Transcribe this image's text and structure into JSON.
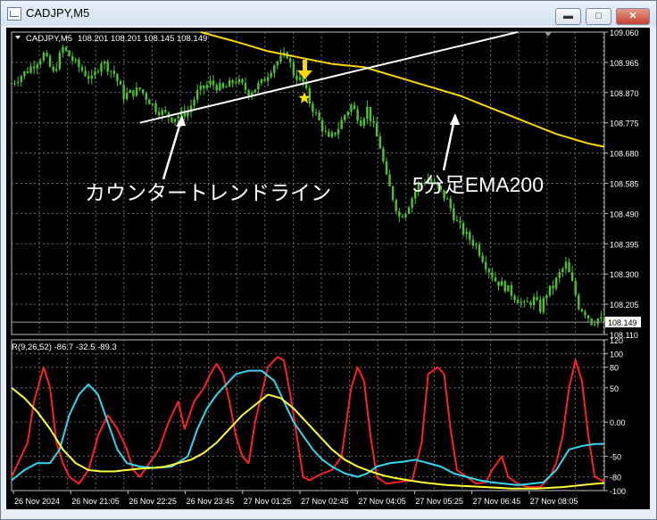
{
  "window": {
    "title": "CADJPY,M5",
    "minimize_glyph": "▬",
    "maximize_glyph": "□",
    "close_glyph": "✕"
  },
  "chart_data": [
    {
      "type": "line",
      "title": "CADJPY,M5  108.201 108.201 108.145 108.149",
      "symbol_label": "CADJPY,M5",
      "ohlc_label": "108.201 108.201 108.145 108.149",
      "ylim": [
        108.11,
        109.06
      ],
      "y_ticks": [
        "109.060",
        "108.965",
        "108.870",
        "108.775",
        "108.680",
        "108.585",
        "108.490",
        "108.395",
        "108.300",
        "108.205",
        "108.110"
      ],
      "current_price": "108.149",
      "x_ticks": [
        "26 Nov 2024",
        "26 Nov 21:05",
        "26 Nov 22:25",
        "26 Nov 23:45",
        "27 Nov 01:25",
        "27 Nov 02:45",
        "27 Nov 04:05",
        "27 Nov 05:25",
        "27 Nov 06:45",
        "27 Nov 08:05"
      ],
      "price_series": [
        [
          0,
          108.9
        ],
        [
          5,
          108.94
        ],
        [
          10,
          108.99
        ],
        [
          13,
          108.93
        ],
        [
          16,
          109.01
        ],
        [
          20,
          108.96
        ],
        [
          25,
          108.91
        ],
        [
          28,
          108.97
        ],
        [
          32,
          108.93
        ],
        [
          35,
          108.86
        ],
        [
          40,
          108.88
        ],
        [
          45,
          108.82
        ],
        [
          50,
          108.79
        ],
        [
          55,
          108.81
        ],
        [
          58,
          108.87
        ],
        [
          62,
          108.9
        ],
        [
          66,
          108.88
        ],
        [
          70,
          108.91
        ],
        [
          74,
          108.87
        ],
        [
          78,
          108.9
        ],
        [
          82,
          108.96
        ],
        [
          86,
          108.99
        ],
        [
          88,
          108.93
        ],
        [
          91,
          108.9
        ],
        [
          93,
          108.84
        ],
        [
          96,
          108.78
        ],
        [
          99,
          108.72
        ],
        [
          102,
          108.76
        ],
        [
          104,
          108.8
        ],
        [
          106,
          108.83
        ],
        [
          109,
          108.78
        ],
        [
          111,
          108.82
        ],
        [
          113,
          108.76
        ],
        [
          115,
          108.7
        ],
        [
          117,
          108.6
        ],
        [
          119,
          108.54
        ],
        [
          121,
          108.48
        ],
        [
          123,
          108.5
        ],
        [
          125,
          108.54
        ],
        [
          127,
          108.58
        ],
        [
          130,
          108.6
        ],
        [
          133,
          108.57
        ],
        [
          136,
          108.53
        ],
        [
          139,
          108.46
        ],
        [
          142,
          108.42
        ],
        [
          145,
          108.39
        ],
        [
          148,
          108.33
        ],
        [
          151,
          108.28
        ],
        [
          154,
          108.26
        ],
        [
          157,
          108.23
        ],
        [
          160,
          108.2
        ],
        [
          163,
          108.22
        ],
        [
          165,
          108.19
        ],
        [
          167,
          108.24
        ],
        [
          169,
          108.26
        ],
        [
          171,
          108.3
        ],
        [
          173,
          108.33
        ],
        [
          175,
          108.27
        ],
        [
          177,
          108.2
        ],
        [
          179,
          108.18
        ],
        [
          181,
          108.15
        ],
        [
          183,
          108.16
        ],
        [
          185,
          108.149
        ]
      ],
      "ema200_series": [
        [
          59,
          109.06
        ],
        [
          70,
          109.03
        ],
        [
          80,
          109.0
        ],
        [
          90,
          108.98
        ],
        [
          100,
          108.96
        ],
        [
          110,
          108.95
        ],
        [
          120,
          108.92
        ],
        [
          130,
          108.89
        ],
        [
          140,
          108.86
        ],
        [
          150,
          108.82
        ],
        [
          160,
          108.78
        ],
        [
          170,
          108.74
        ],
        [
          180,
          108.71
        ],
        [
          185,
          108.7
        ]
      ],
      "trendline": {
        "from": [
          40,
          108.775
        ],
        "to": [
          160,
          109.065
        ]
      },
      "annotations": {
        "trendline_label": "カウンタートレンドライン",
        "ema_label": "5分足EMA200"
      },
      "colors": {
        "price": "#4dc32c",
        "ema": "#ffd700",
        "trendline": "#ffffff",
        "arrow": "#ffd700",
        "star": "#ffe600"
      }
    },
    {
      "type": "line",
      "title": "R(9,26,52) -86.7 -32.5 -89.3",
      "ylim": [
        -100,
        120
      ],
      "y_ticks": [
        "120",
        "100",
        "80",
        "50",
        "0.00",
        "-50",
        "-80",
        "-100"
      ],
      "series": [
        {
          "values": [
            [
              0,
              -80
            ],
            [
              2,
              -60
            ],
            [
              5,
              -30
            ],
            [
              7,
              30
            ],
            [
              10,
              80
            ],
            [
              12,
              50
            ],
            [
              14,
              -30
            ],
            [
              16,
              -60
            ],
            [
              18,
              -80
            ],
            [
              21,
              -90
            ],
            [
              24,
              -70
            ],
            [
              27,
              -20
            ],
            [
              30,
              10
            ],
            [
              33,
              -10
            ],
            [
              36,
              -40
            ],
            [
              38,
              -70
            ],
            [
              40,
              -80
            ],
            [
              43,
              -60
            ],
            [
              46,
              -40
            ],
            [
              49,
              0
            ],
            [
              52,
              30
            ],
            [
              54,
              -10
            ],
            [
              57,
              30
            ],
            [
              60,
              50
            ],
            [
              62,
              70
            ],
            [
              64,
              85
            ],
            [
              66,
              70
            ],
            [
              68,
              30
            ],
            [
              70,
              -20
            ],
            [
              72,
              -50
            ],
            [
              74,
              -60
            ],
            [
              76,
              0
            ],
            [
              78,
              40
            ],
            [
              80,
              80
            ],
            [
              83,
              95
            ],
            [
              85,
              90
            ],
            [
              87,
              40
            ],
            [
              89,
              -20
            ],
            [
              91,
              -80
            ],
            [
              93,
              -85
            ],
            [
              95,
              -80
            ],
            [
              97,
              -75
            ],
            [
              100,
              -70
            ],
            [
              103,
              -50
            ],
            [
              106,
              50
            ],
            [
              108,
              80
            ],
            [
              110,
              60
            ],
            [
              112,
              -20
            ],
            [
              114,
              -80
            ],
            [
              117,
              -90
            ],
            [
              120,
              -88
            ],
            [
              125,
              -85
            ],
            [
              128,
              -30
            ],
            [
              130,
              70
            ],
            [
              133,
              80
            ],
            [
              135,
              70
            ],
            [
              137,
              -10
            ],
            [
              139,
              -70
            ],
            [
              142,
              -80
            ],
            [
              145,
              -90
            ],
            [
              148,
              -88
            ],
            [
              150,
              -70
            ],
            [
              153,
              -50
            ],
            [
              155,
              -80
            ],
            [
              158,
              -90
            ],
            [
              161,
              -95
            ],
            [
              165,
              -95
            ],
            [
              168,
              -80
            ],
            [
              170,
              -60
            ],
            [
              172,
              -20
            ],
            [
              174,
              50
            ],
            [
              176,
              90
            ],
            [
              178,
              60
            ],
            [
              180,
              -20
            ],
            [
              182,
              -80
            ],
            [
              185,
              -87
            ]
          ],
          "color": "#ff2020"
        },
        {
          "values": [
            [
              0,
              -85
            ],
            [
              4,
              -70
            ],
            [
              8,
              -60
            ],
            [
              12,
              -60
            ],
            [
              15,
              -40
            ],
            [
              18,
              10
            ],
            [
              21,
              40
            ],
            [
              24,
              55
            ],
            [
              27,
              40
            ],
            [
              30,
              0
            ],
            [
              33,
              -40
            ],
            [
              36,
              -60
            ],
            [
              40,
              -65
            ],
            [
              45,
              -67
            ],
            [
              50,
              -65
            ],
            [
              55,
              -50
            ],
            [
              58,
              -10
            ],
            [
              61,
              20
            ],
            [
              64,
              40
            ],
            [
              67,
              55
            ],
            [
              70,
              70
            ],
            [
              74,
              75
            ],
            [
              78,
              75
            ],
            [
              82,
              60
            ],
            [
              85,
              30
            ],
            [
              88,
              0
            ],
            [
              91,
              -20
            ],
            [
              94,
              -40
            ],
            [
              97,
              -55
            ],
            [
              100,
              -65
            ],
            [
              104,
              -75
            ],
            [
              108,
              -80
            ],
            [
              111,
              -75
            ],
            [
              114,
              -65
            ],
            [
              118,
              -60
            ],
            [
              122,
              -58
            ],
            [
              126,
              -55
            ],
            [
              130,
              -60
            ],
            [
              134,
              -65
            ],
            [
              138,
              -75
            ],
            [
              142,
              -80
            ],
            [
              146,
              -85
            ],
            [
              150,
              -88
            ],
            [
              154,
              -90
            ],
            [
              158,
              -92
            ],
            [
              162,
              -90
            ],
            [
              166,
              -88
            ],
            [
              170,
              -70
            ],
            [
              174,
              -40
            ],
            [
              178,
              -35
            ],
            [
              182,
              -32
            ],
            [
              185,
              -32
            ]
          ],
          "color": "#2fd8f2"
        },
        {
          "values": [
            [
              0,
              50
            ],
            [
              4,
              35
            ],
            [
              8,
              15
            ],
            [
              12,
              -10
            ],
            [
              16,
              -40
            ],
            [
              20,
              -60
            ],
            [
              24,
              -70
            ],
            [
              28,
              -72
            ],
            [
              32,
              -72
            ],
            [
              36,
              -70
            ],
            [
              40,
              -68
            ],
            [
              44,
              -67
            ],
            [
              48,
              -65
            ],
            [
              52,
              -60
            ],
            [
              56,
              -55
            ],
            [
              60,
              -45
            ],
            [
              64,
              -30
            ],
            [
              68,
              -10
            ],
            [
              72,
              10
            ],
            [
              76,
              25
            ],
            [
              80,
              40
            ],
            [
              84,
              35
            ],
            [
              88,
              20
            ],
            [
              92,
              0
            ],
            [
              96,
              -20
            ],
            [
              100,
              -40
            ],
            [
              104,
              -55
            ],
            [
              108,
              -65
            ],
            [
              112,
              -72
            ],
            [
              116,
              -78
            ],
            [
              120,
              -82
            ],
            [
              124,
              -85
            ],
            [
              128,
              -88
            ],
            [
              132,
              -90
            ],
            [
              136,
              -92
            ],
            [
              140,
              -93
            ],
            [
              144,
              -94
            ],
            [
              148,
              -95
            ],
            [
              152,
              -96
            ],
            [
              156,
              -97
            ],
            [
              160,
              -97
            ],
            [
              164,
              -97
            ],
            [
              168,
              -96
            ],
            [
              172,
              -95
            ],
            [
              176,
              -93
            ],
            [
              180,
              -91
            ],
            [
              185,
              -89
            ]
          ],
          "color": "#ffff33"
        }
      ]
    }
  ]
}
